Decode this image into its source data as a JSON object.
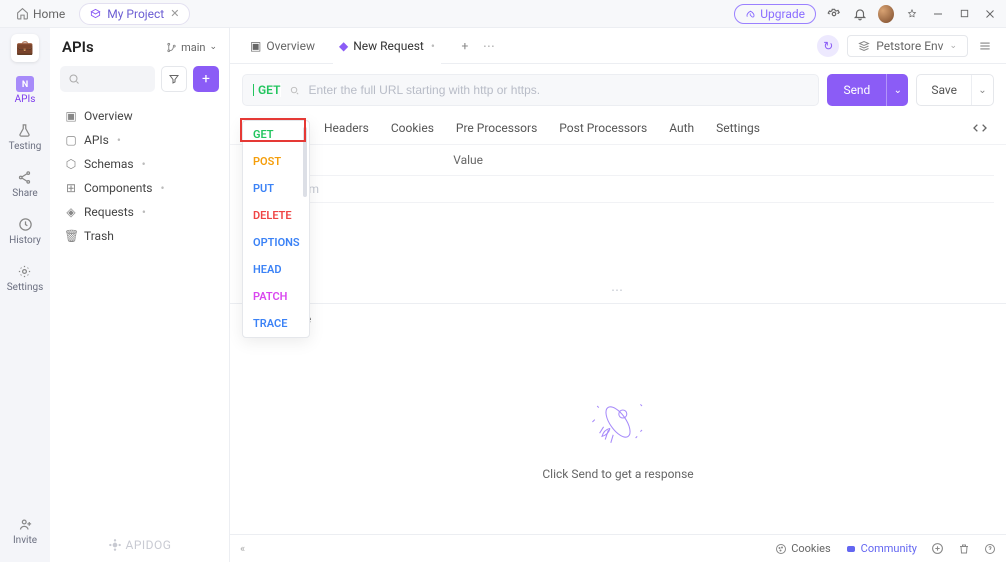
{
  "titlebar": {
    "home": "Home",
    "project": "My Project",
    "upgrade": "Upgrade"
  },
  "rail": {
    "apis": "APIs",
    "testing": "Testing",
    "share": "Share",
    "history": "History",
    "settings": "Settings",
    "invite": "Invite"
  },
  "sidebar": {
    "title": "APIs",
    "branch": "main",
    "tree": {
      "overview": "Overview",
      "apis": "APIs",
      "schemas": "Schemas",
      "components": "Components",
      "requests": "Requests",
      "trash": "Trash"
    },
    "brand": "APIDOG"
  },
  "tabs": {
    "overview": "Overview",
    "new_request": "New Request",
    "env": "Petstore Env"
  },
  "url": {
    "method": "GET",
    "placeholder": "Enter the full URL starting with http or https.",
    "send": "Send",
    "save": "Save"
  },
  "reqtabs": {
    "headers": "Headers",
    "cookies": "Cookies",
    "pre": "Pre Processors",
    "post": "Post Processors",
    "auth": "Auth",
    "settings": "Settings"
  },
  "table": {
    "value_header": "Value",
    "add_placeholder": "am"
  },
  "response": {
    "header": "Response",
    "empty": "Click Send to get a response"
  },
  "methods": [
    {
      "label": "GET",
      "color": "#22c55e"
    },
    {
      "label": "POST",
      "color": "#f59e0b"
    },
    {
      "label": "PUT",
      "color": "#3b82f6"
    },
    {
      "label": "DELETE",
      "color": "#ef4444"
    },
    {
      "label": "OPTIONS",
      "color": "#3b82f6"
    },
    {
      "label": "HEAD",
      "color": "#3b82f6"
    },
    {
      "label": "PATCH",
      "color": "#d946ef"
    },
    {
      "label": "TRACE",
      "color": "#3b82f6"
    }
  ],
  "statusbar": {
    "cookies": "Cookies",
    "community": "Community"
  }
}
